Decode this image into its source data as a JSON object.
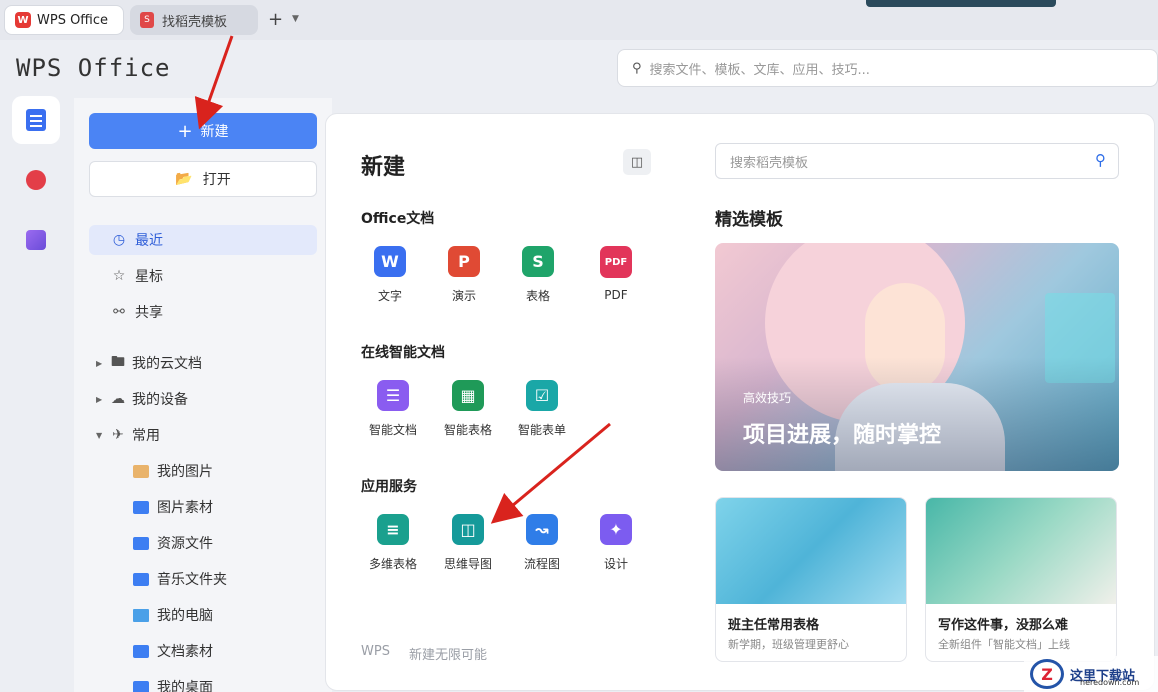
{
  "tabs": [
    {
      "label": "WPS Office"
    },
    {
      "label": "找稻壳模板"
    }
  ],
  "brand": "WPS Office",
  "global_search": {
    "placeholder": "搜索文件、模板、文库、应用、技巧..."
  },
  "sidebar": {
    "new_label": "新建",
    "open_label": "打开",
    "nav": [
      {
        "label": "最近"
      },
      {
        "label": "星标"
      },
      {
        "label": "共享"
      }
    ],
    "tree": [
      {
        "label": "我的云文档"
      },
      {
        "label": "我的设备"
      },
      {
        "label": "常用"
      }
    ],
    "common": [
      {
        "label": "我的图片"
      },
      {
        "label": "图片素材"
      },
      {
        "label": "资源文件"
      },
      {
        "label": "音乐文件夹"
      },
      {
        "label": "我的电脑"
      },
      {
        "label": "文档素材"
      },
      {
        "label": "我的桌面"
      }
    ]
  },
  "panel": {
    "title": "新建",
    "office_section": "Office文档",
    "office_apps": [
      {
        "label": "文字",
        "glyph": "W",
        "color": "#3a6ff0"
      },
      {
        "label": "演示",
        "glyph": "P",
        "color": "#e04a34"
      },
      {
        "label": "表格",
        "glyph": "S",
        "color": "#1fa46a"
      },
      {
        "label": "PDF",
        "glyph": "PDF",
        "color": "#e2355a"
      }
    ],
    "online_section": "在线智能文档",
    "online_apps": [
      {
        "label": "智能文档",
        "color": "#8a5cf0"
      },
      {
        "label": "智能表格",
        "color": "#1f9a58"
      },
      {
        "label": "智能表单",
        "color": "#1aa7a7"
      }
    ],
    "service_section": "应用服务",
    "service_apps": [
      {
        "label": "多维表格",
        "color": "#1aa08e"
      },
      {
        "label": "思维导图",
        "color": "#159a9a"
      },
      {
        "label": "流程图",
        "color": "#2f7de8"
      },
      {
        "label": "设计",
        "color": "#7c5cf0"
      }
    ],
    "footer_brand": "WPS",
    "footer_slogan": "新建无限可能"
  },
  "templates": {
    "search_placeholder": "搜索稻壳模板",
    "featured_title": "精选模板",
    "hero_tag": "高效技巧",
    "hero_title": "项目进展，随时掌控",
    "cards": [
      {
        "title": "班主任常用表格",
        "subtitle": "新学期，班级管理更舒心"
      },
      {
        "title": "写作这件事，没那么难",
        "subtitle": "全新组件「智能文档」上线"
      }
    ]
  },
  "watermark": {
    "title": "这里下载站",
    "url": "heredown.com"
  }
}
